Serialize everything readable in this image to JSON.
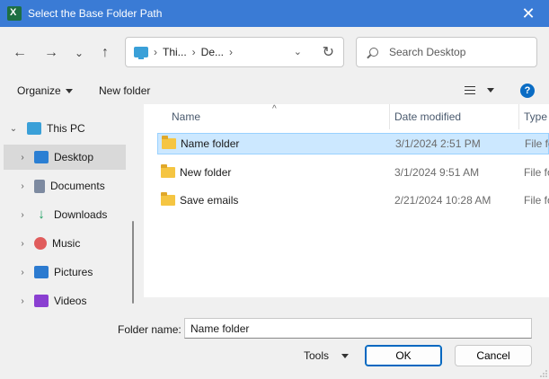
{
  "window": {
    "title": "Select the Base Folder Path",
    "close_glyph": "✕"
  },
  "nav_buttons": {
    "back": "←",
    "forward": "→",
    "recent": "⌄",
    "up": "↑"
  },
  "address": {
    "crumbs": [
      "Thi...",
      "De..."
    ],
    "separator": "›",
    "dropdown": "⌄",
    "refresh": "↻"
  },
  "search": {
    "placeholder": "Search Desktop"
  },
  "toolbar": {
    "organize_label": "Organize",
    "new_folder_label": "New folder",
    "help": "?"
  },
  "navpane": {
    "items": [
      {
        "label": "This PC",
        "icon": "pc-icon",
        "chevron": "⌄"
      },
      {
        "label": "Desktop",
        "icon": "desktop-icon",
        "chevron": "›",
        "selected": true
      },
      {
        "label": "Documents",
        "icon": "documents-icon",
        "chevron": "›"
      },
      {
        "label": "Downloads",
        "icon": "downloads-icon",
        "chevron": "›",
        "glyph": "↓"
      },
      {
        "label": "Music",
        "icon": "music-icon",
        "chevron": "›"
      },
      {
        "label": "Pictures",
        "icon": "pictures-icon",
        "chevron": "›"
      },
      {
        "label": "Videos",
        "icon": "videos-icon",
        "chevron": "›"
      }
    ]
  },
  "filepane": {
    "columns": {
      "name": "Name",
      "date": "Date modified",
      "type": "Type"
    },
    "sort_glyph": "^",
    "rows": [
      {
        "name": "Name folder",
        "date": "3/1/2024 2:51 PM",
        "type": "File fo",
        "selected": true
      },
      {
        "name": "New folder",
        "date": "3/1/2024 9:51 AM",
        "type": "File fo"
      },
      {
        "name": "Save emails",
        "date": "2/21/2024 10:28 AM",
        "type": "File fo"
      }
    ]
  },
  "footer": {
    "folder_name_label": "Folder name:",
    "folder_name_value": "Name folder",
    "tools_label": "Tools",
    "ok_label": "OK",
    "cancel_label": "Cancel"
  },
  "colors": {
    "titlebar": "#3a7bd5",
    "selection": "#cce8ff",
    "accent": "#0067c0"
  }
}
